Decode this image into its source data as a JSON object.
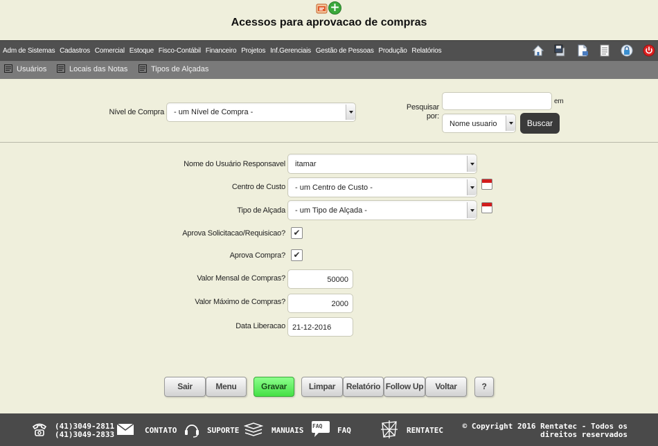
{
  "page": {
    "title": "Acessos para aprovacao de compras"
  },
  "menu": {
    "items": [
      "Adm de Sistemas",
      "Cadastros",
      "Comercial",
      "Estoque",
      "Fisco-Contábil",
      "Financeiro",
      "Projetos",
      "Inf.Gerenciais",
      "Gestão de Pessoas",
      "Produção",
      "Relatórios"
    ],
    "icons": [
      "home-icon",
      "save-disk-icon",
      "document-icon",
      "list-icon",
      "lock-icon",
      "power-icon"
    ]
  },
  "submenu": {
    "items": [
      "Usuários",
      "Locais das Notas",
      "Tipos de Alçadas"
    ]
  },
  "filter": {
    "nivel_label": "Nível de Compra",
    "nivel_value": "- um Nível de Compra -",
    "search_label": "Pesquisar por:",
    "search_value": "",
    "em_label": "em",
    "search_field_value": "Nome usuario",
    "buscar_label": "Buscar"
  },
  "form": {
    "usuario_label": "Nome do Usuário Responsavel",
    "usuario_value": "itamar",
    "centro_label": "Centro de Custo",
    "centro_value": "- um Centro de Custo -",
    "tipo_label": "Tipo de Alçada",
    "tipo_value": "- um Tipo de Alçada -",
    "aprova_sol_label": "Aprova Solicitacao/Requisicao?",
    "aprova_sol_checked": true,
    "aprova_compra_label": "Aprova Compra?",
    "aprova_compra_checked": true,
    "check_glyph": "✔",
    "valor_mensal_label": "Valor Mensal de Compras?",
    "valor_mensal_value": "50000",
    "valor_max_label": "Valor Máximo de Compras?",
    "valor_max_value": "2000",
    "data_label": "Data Liberacao",
    "data_value": "21-12-2016"
  },
  "buttons": {
    "sair": "Sair",
    "menu": "Menu",
    "gravar": "Gravar",
    "limpar": "Limpar",
    "relatorio": "Relatório",
    "followup": "Follow Up",
    "voltar": "Voltar",
    "help": "?"
  },
  "footer": {
    "phone1": "(41)3049-2811",
    "phone2": "(41)3049-2833",
    "contato": "CONTATO",
    "suporte": "SUPORTE",
    "manuais": "MANUAIS",
    "faq_badge": "FAQ",
    "faq": "FAQ",
    "rentatec": "RENTATEC",
    "copyright1": "© Copyright 2016 Rentatec - Todos os",
    "copyright2": "direitos reservados"
  },
  "colors": {
    "background": "#efefdc",
    "menubar": "#505050",
    "submenu": "#7a7a7a",
    "footer": "#4a4a4a",
    "save_button": "#45e045"
  }
}
